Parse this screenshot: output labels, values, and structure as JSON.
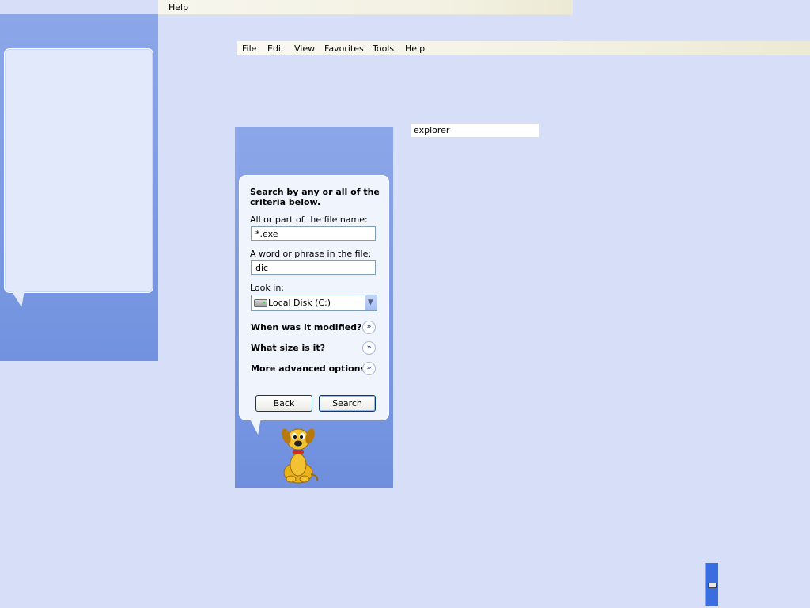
{
  "top_menu": {
    "help": "Help"
  },
  "menubar": {
    "items": [
      "File",
      "Edit",
      "View",
      "Favorites",
      "Tools",
      "Help"
    ]
  },
  "search": {
    "heading": "Search by any or all of the criteria below.",
    "filename_label": "All or part of the file name:",
    "filename_value": "*.exe",
    "phrase_label": "A word or phrase in the file:",
    "phrase_value": "dic",
    "lookin_label": "Look in:",
    "lookin_value": "Local Disk (C:)",
    "options": [
      "When was it modified?",
      "What size is it?",
      "More advanced options"
    ],
    "back_label": "Back",
    "search_label": "Search"
  },
  "address_field": {
    "value": "explorer"
  },
  "icons": {
    "drive": "local-disk-icon",
    "expand": "double-chevron-down-icon",
    "companion": "search-dog-rover",
    "keyboard": "keyboard-icon"
  },
  "colors": {
    "panel": "#8ca7e8",
    "background": "#d6dff7",
    "button_border": "#003c74"
  }
}
